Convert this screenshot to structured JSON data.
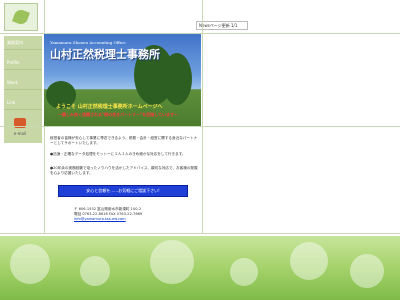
{
  "nav": {
    "items": [
      {
        "label": "業務案内"
      },
      {
        "label": "Profile"
      },
      {
        "label": "Week"
      },
      {
        "label": "Link"
      }
    ],
    "email_label": "e-mail"
  },
  "header": {
    "page_label": "Newsページ更新 1/1"
  },
  "banner": {
    "subtitle": "Yamamura Shonen Accounting Office",
    "title": "山村正然税理士事務所",
    "welcome": "ようこそ 山村正然税理士事務所ホームページへ",
    "tagline": "～親しみ良く信頼される\"税の良きパートナー\"を目指しています～"
  },
  "content": {
    "paragraph1": "経営者の皆様が安心して事業に専念できるよう、税務・会計・経営に関する身近なパートナーとしてサポートいたします。",
    "bullet1": "●迅速・正確なデータ処理をモットーに１人１人のきめ細かな対応をして行きます。",
    "bullet2": "●20年余の実務経験で培ったノウハウを活かしたアドバイス、親切な対応で、お客様の発展を心より応援いたします。",
    "cta": "安心と信頼を……お気軽にご相談下さい!",
    "address_line1": "〒 606-1552 富山県射水市新湊町 100-2",
    "address_line2": "電話 0763-22-8616   FAX 0763-22-7669",
    "email": "info@yamamura.tax-ew.com"
  },
  "colors": {
    "accent": "#1f3fd6",
    "nav_bg": "#c8d7a6",
    "footer_green": "#a5d26b"
  }
}
